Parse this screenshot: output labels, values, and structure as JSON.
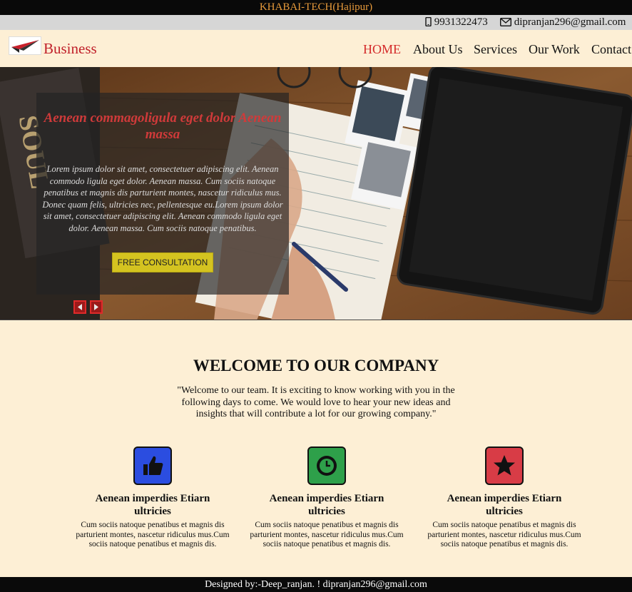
{
  "topbar": {
    "title": "KHABAI-TECH(Hajipur)"
  },
  "contact": {
    "phone": "9931322473",
    "email": "dipranjan296@gmail.com"
  },
  "nav": {
    "brand": "Business",
    "items": [
      {
        "label": "HOME",
        "active": true
      },
      {
        "label": "About Us"
      },
      {
        "label": "Services"
      },
      {
        "label": "Our Work"
      },
      {
        "label": "Contact"
      }
    ]
  },
  "hero": {
    "title": "Aenean commagoligula eget dolor Aenean massa",
    "text": "Lorem ipsum dolor sit amet, consectetuer adipiscing elit. Aenean commodo ligula eget dolor. Aenean massa. Cum sociis natoque penatibus et magnis dis parturient montes, nascetur ridiculus mus. Donec quam felis, ultricies nec, pellentesque eu.Lorem ipsum dolor sit amet, consectetuer adipiscing elit. Aenean commodo ligula eget dolor. Aenean massa. Cum sociis natoque penatibus.",
    "button": "FREE CONSULTATION"
  },
  "welcome": {
    "title": "WELCOME TO OUR COMPANY",
    "text": "\"Welcome to our team. It is exciting to know working with you in the following days to come. We would love to hear your new ideas and insights that will contribute a lot for our growing company.\""
  },
  "features": [
    {
      "icon": "thumbs-up-icon",
      "color": "#2b4de0",
      "title": "Aenean imperdies Etiarn ultricies",
      "text": "Cum sociis natoque penatibus et magnis dis parturient montes, nascetur ridiculus mus.Cum sociis natoque penatibus et magnis dis."
    },
    {
      "icon": "clock-icon",
      "color": "#2ea04a",
      "title": "Aenean imperdies Etiarn ultricies",
      "text": "Cum sociis natoque penatibus et magnis dis parturient montes, nascetur ridiculus mus.Cum sociis natoque penatibus et magnis dis."
    },
    {
      "icon": "star-icon",
      "color": "#d83c46",
      "title": "Aenean imperdies Etiarn ultricies",
      "text": "Cum sociis natoque penatibus et magnis dis parturient montes, nascetur ridiculus mus.Cum sociis natoque penatibus et magnis dis."
    }
  ],
  "footer": {
    "text": "Designed by:-Deep_ranjan. ! dipranjan296@gmail.com"
  }
}
